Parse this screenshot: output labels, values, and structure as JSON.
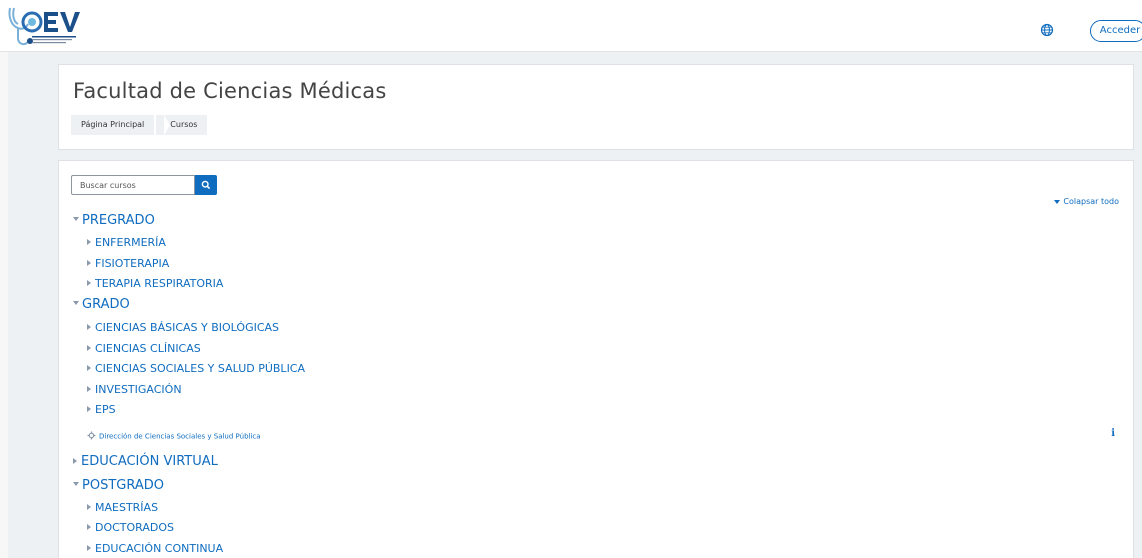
{
  "navbar": {
    "logo_name": "CEV",
    "language_icon": "globe-icon",
    "login_label": "Acceder"
  },
  "header": {
    "title": "Facultad de Ciencias Médicas",
    "breadcrumb": [
      "Página Principal",
      "Cursos"
    ]
  },
  "search": {
    "placeholder": "Buscar cursos",
    "button_icon": "search-icon"
  },
  "collapse_all_label": "Colapsar todo",
  "categories": {
    "pregrado": {
      "label": "PREGRADO",
      "children": [
        "ENFERMERÍA",
        "FISIOTERAPIA",
        "TERAPIA RESPIRATORIA"
      ]
    },
    "grado": {
      "label": "GRADO",
      "children": [
        "CIENCIAS BÁSICAS Y BIOLÓGICAS",
        "CIENCIAS CLÍNICAS",
        "CIENCIAS SOCIALES Y SALUD PÚBLICA",
        "INVESTIGACIÓN",
        "EPS"
      ]
    },
    "course_link": "Dirección de Ciencias Sociales y Salud Pública",
    "educacion_virtual": {
      "label": "EDUCACIÓN VIRTUAL"
    },
    "postgrado": {
      "label": "POSTGRADO",
      "children": [
        "MAESTRÍAS",
        "DOCTORADOS",
        "EDUCACIÓN CONTINUA"
      ]
    }
  },
  "colors": {
    "link": "#0f6cbf",
    "background": "#eef1f4"
  }
}
